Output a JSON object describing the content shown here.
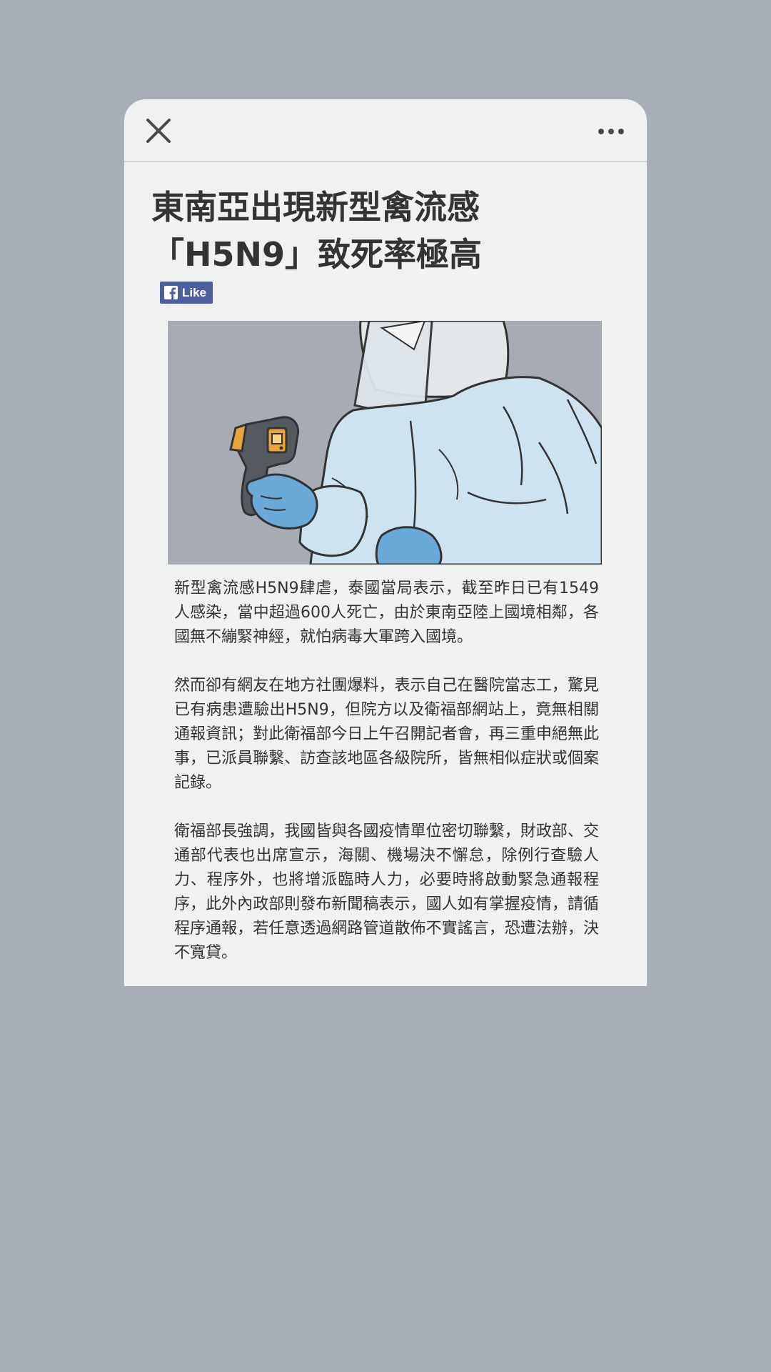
{
  "article": {
    "title_line1": "東南亞出現新型禽流感",
    "title_line2": "「H5N9」致死率極高",
    "like_label": "Like",
    "paragraphs": [
      "新型禽流感H5N9肆虐，泰國當局表示，截至昨日已有1549人感染，當中超過600人死亡，由於東南亞陸上國境相鄰，各國無不繃緊神經，就怕病毒大軍跨入國境。",
      "然而卻有網友在地方社團爆料，表示自己在醫院當志工，驚見已有病患遭驗出H5N9，但院方以及衛福部網站上，竟無相關通報資訊；對此衛福部今日上午召開記者會，再三重申絕無此事，已派員聯繫、訪查該地區各級院所，皆無相似症狀或個案記錄。",
      "衛福部長強調，我國皆與各國疫情單位密切聯繫，財政部、交通部代表也出席宣示，海關、機場決不懈怠，除例行查驗人力、程序外，也將增派臨時人力，必要時將啟動緊急通報程序，此外內政部則發布新聞稿表示，國人如有掌握疫情，請循程序通報，若任意透過網路管道散佈不實謠言，恐遭法辦，決不寬貸。"
    ]
  },
  "icons": {
    "close": "close-icon",
    "more": "more-icon",
    "facebook": "facebook-icon"
  },
  "colors": {
    "background": "#a8aeb6",
    "card": "#f0f1f1",
    "text": "#333333",
    "facebook": "#4b5f9d",
    "suit": "#cfe2f0",
    "glove": "#6aaad8",
    "thermometer": "#e8a53c"
  }
}
